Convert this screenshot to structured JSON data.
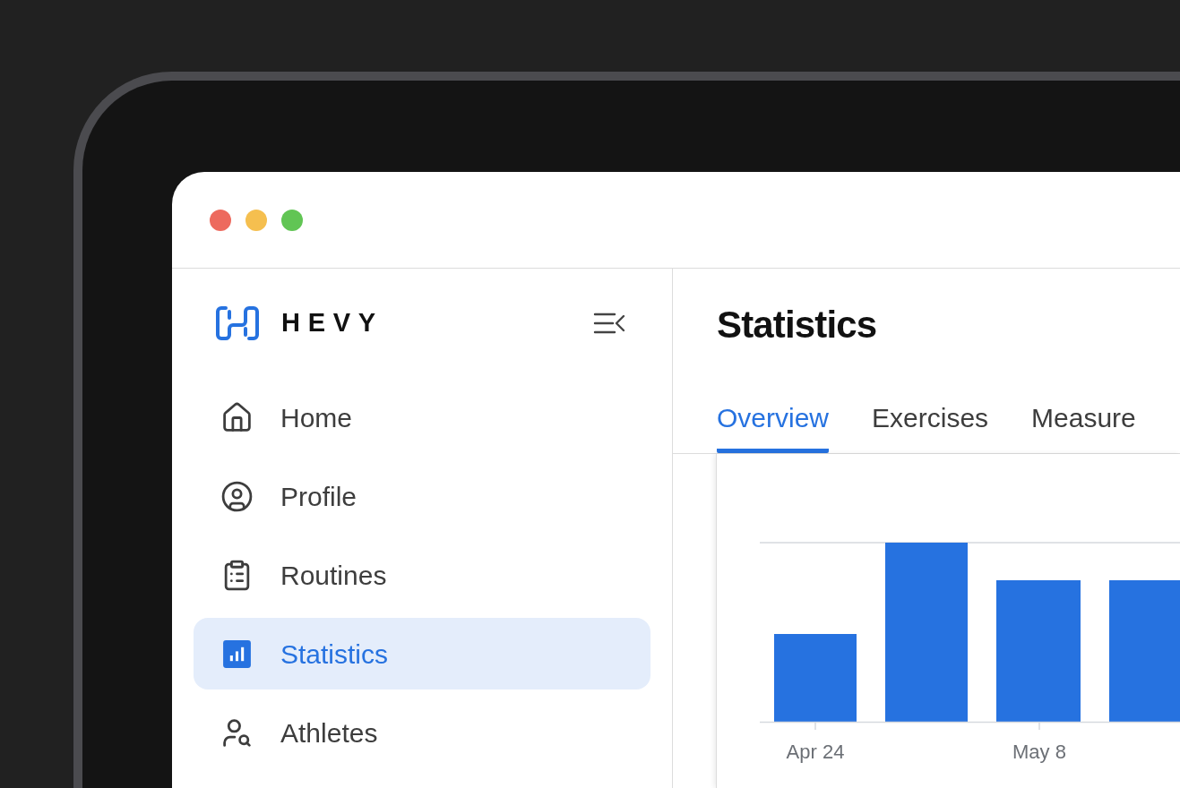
{
  "window": {
    "controls": [
      {
        "color": "#ed6a5e"
      },
      {
        "color": "#f5bf4f"
      },
      {
        "color": "#61c554"
      }
    ]
  },
  "sidebar": {
    "brand": "HEVY",
    "items": [
      {
        "label": "Home",
        "selected": false
      },
      {
        "label": "Profile",
        "selected": false
      },
      {
        "label": "Routines",
        "selected": false
      },
      {
        "label": "Statistics",
        "selected": true
      },
      {
        "label": "Athletes",
        "selected": false
      }
    ]
  },
  "main": {
    "title": "Statistics",
    "tabs": [
      {
        "label": "Overview",
        "selected": true
      },
      {
        "label": "Exercises",
        "selected": false
      },
      {
        "label": "Measure",
        "selected": false
      }
    ],
    "chart": {
      "x_labels": [
        "Apr 24",
        "May 8"
      ]
    }
  }
}
